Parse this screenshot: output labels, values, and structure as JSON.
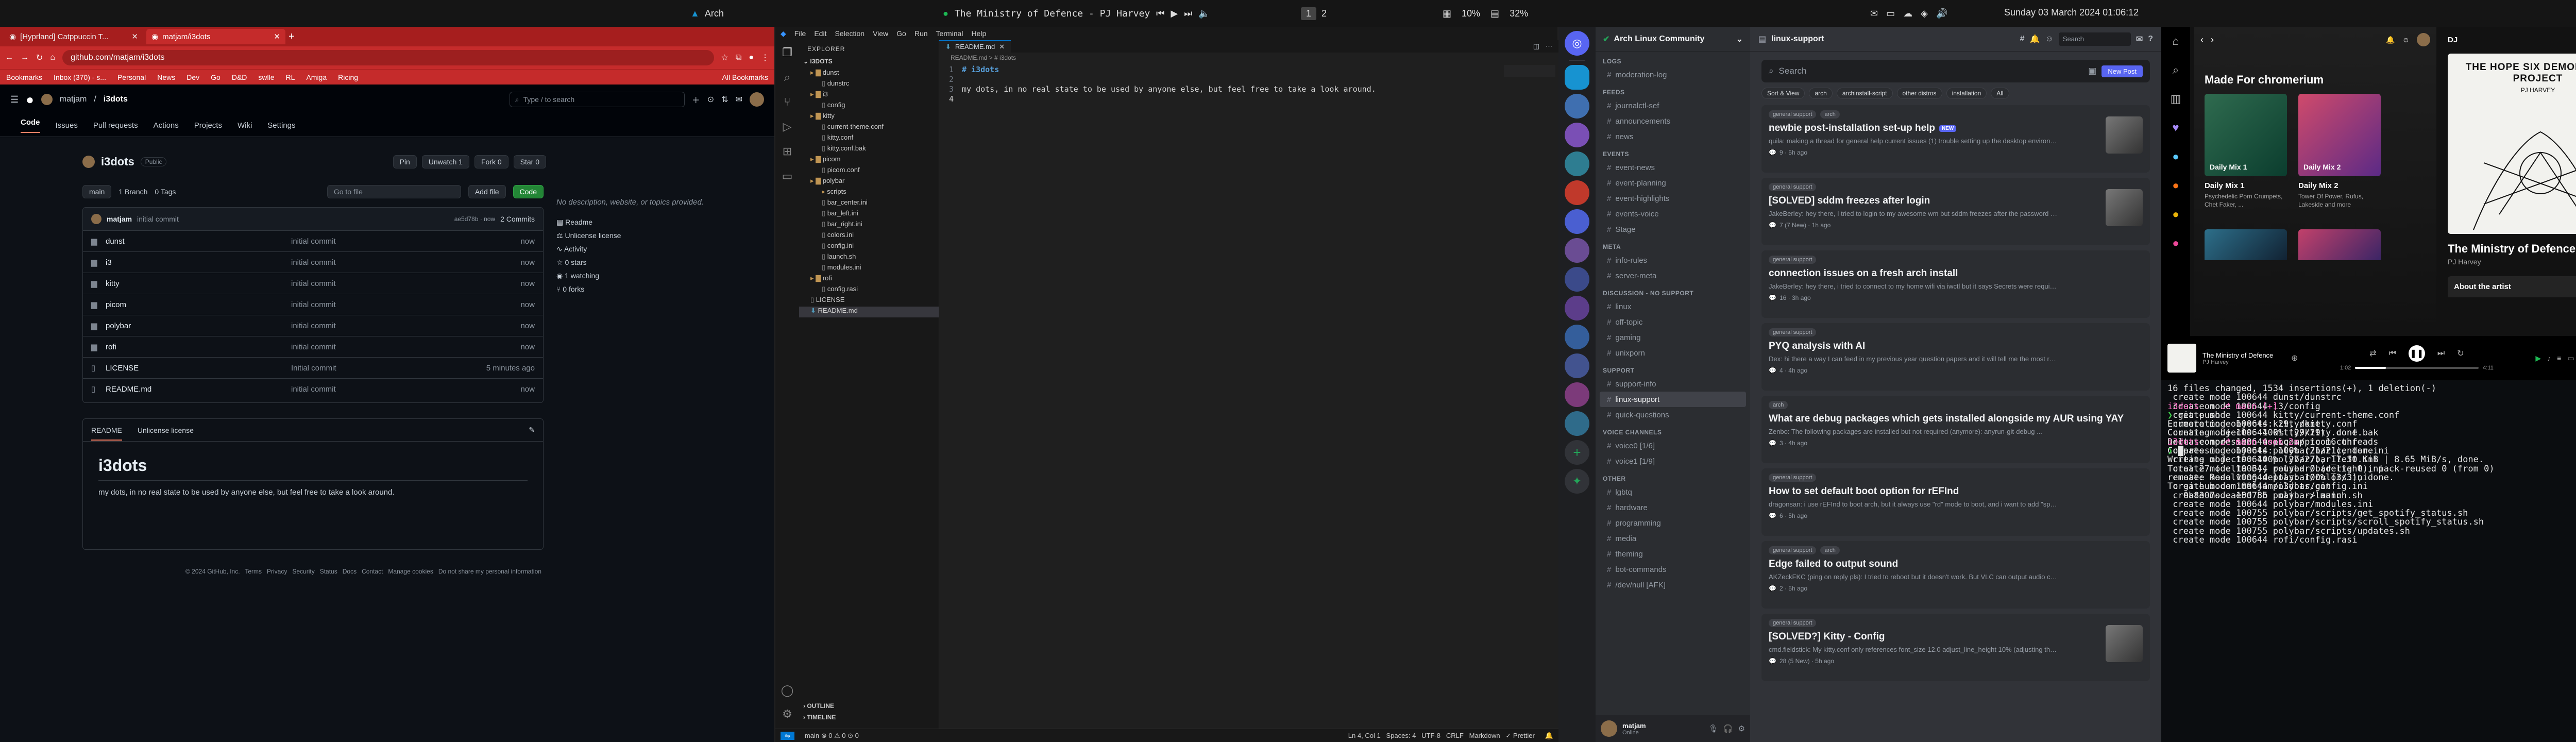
{
  "topbar": {
    "distro": "Arch",
    "now_playing": "The Ministry of Defence - PJ Harvey",
    "ws1": "1",
    "ws2": "2",
    "cpu": "10%",
    "mem": "32%",
    "datetime": "Sunday 03 March 2024 01:06:12"
  },
  "chrome": {
    "tabs": [
      {
        "label": "[Hyprland] Catppuccin T..."
      },
      {
        "label": "matjam/i3dots"
      }
    ],
    "url": "github.com/matjam/i3dots",
    "bookmarks": [
      "Bookmarks",
      "Inbox (370) - s...",
      "Personal",
      "News",
      "Dev",
      "Go",
      "D&D",
      "swlle",
      "RL",
      "Amiga",
      "Ricing",
      "All Bookmarks"
    ],
    "github": {
      "owner": "matjam",
      "repo": "i3dots",
      "search_placeholder": "Type / to search",
      "nav": [
        "Code",
        "Issues",
        "Pull requests",
        "Actions",
        "Projects",
        "Wiki",
        "Settings"
      ],
      "visibility": "Public",
      "pin": "Pin",
      "unwatch": "Unwatch",
      "unwatch_count": "1",
      "fork": "Fork",
      "fork_count": "0",
      "star": "Star",
      "star_count": "0",
      "branch": "main",
      "branch_count": "1 Branch",
      "tag_count": "0 Tags",
      "goto_file": "Go to file",
      "add_file": "Add file",
      "code": "Code",
      "commit_author": "matjam",
      "commit_msg": "initial commit",
      "commit_hash": "ae5d78b · now",
      "commit_count": "2 Commits",
      "files": [
        {
          "name": "dunst",
          "msg": "initial commit",
          "age": "now"
        },
        {
          "name": "i3",
          "msg": "initial commit",
          "age": "now"
        },
        {
          "name": "kitty",
          "msg": "initial commit",
          "age": "now"
        },
        {
          "name": "picom",
          "msg": "initial commit",
          "age": "now"
        },
        {
          "name": "polybar",
          "msg": "initial commit",
          "age": "now"
        },
        {
          "name": "rofi",
          "msg": "initial commit",
          "age": "now"
        },
        {
          "name": "LICENSE",
          "msg": "Initial commit",
          "age": "5 minutes ago"
        },
        {
          "name": "README.md",
          "msg": "initial commit",
          "age": "now"
        }
      ],
      "readme_tab": "README",
      "license_tab": "Unlicense license",
      "readme_title": "i3dots",
      "readme_body": "my dots, in no real state to be used by anyone else, but feel free to take a look around.",
      "about_desc": "No description, website, or topics provided.",
      "about_items": [
        "Readme",
        "Unlicense license",
        "Activity",
        "0 stars",
        "1 watching",
        "0 forks"
      ],
      "footer": "© 2024 GitHub, Inc.   Terms   Privacy   Security   Status   Docs   Contact   Manage cookies   Do not share my personal information"
    }
  },
  "vscode": {
    "menu": [
      "File",
      "Edit",
      "Selection",
      "View",
      "Go",
      "Run",
      "Terminal",
      "Help"
    ],
    "explorer_title": "EXPLORER",
    "root": "I3DOTS",
    "tree": [
      {
        "label": "dunst",
        "d": 1
      },
      {
        "label": "dunstrc",
        "d": 2
      },
      {
        "label": "i3",
        "d": 1
      },
      {
        "label": "config",
        "d": 2
      },
      {
        "label": "kitty",
        "d": 1
      },
      {
        "label": "current-theme.conf",
        "d": 2
      },
      {
        "label": "kitty.conf",
        "d": 2
      },
      {
        "label": "kitty.conf.bak",
        "d": 2
      },
      {
        "label": "picom",
        "d": 1
      },
      {
        "label": "picom.conf",
        "d": 2
      },
      {
        "label": "polybar",
        "d": 1
      },
      {
        "label": "scripts",
        "d": 2
      },
      {
        "label": "bar_center.ini",
        "d": 2
      },
      {
        "label": "bar_left.ini",
        "d": 2
      },
      {
        "label": "bar_right.ini",
        "d": 2
      },
      {
        "label": "colors.ini",
        "d": 2
      },
      {
        "label": "config.ini",
        "d": 2
      },
      {
        "label": "launch.sh",
        "d": 2
      },
      {
        "label": "modules.ini",
        "d": 2
      },
      {
        "label": "rofi",
        "d": 1
      },
      {
        "label": "config.rasi",
        "d": 2
      },
      {
        "label": "LICENSE",
        "d": 1
      },
      {
        "label": "README.md",
        "d": 1
      }
    ],
    "outline": "OUTLINE",
    "timeline": "TIMELINE",
    "tab": "README.md",
    "breadcrumb": "README.md > # i3dots",
    "line1": "# i3dots",
    "line3": "my dots, in no real state to be used by anyone else, but feel free to take a look around.",
    "status_left": "main  ⊗ 0 ⚠ 0  ⊙ 0",
    "status_right": "Ln 4, Col 1   Spaces: 4   UTF-8   CRLF   Markdown   ✓ Prettier"
  },
  "discord": {
    "server": "Arch Linux Community",
    "channel": "linux-support",
    "search": "Search",
    "forum_search": "Search",
    "new_post": "New Post",
    "filters": [
      "Sort & View",
      "arch",
      "archinstall-script",
      "other distros",
      "installation",
      "All"
    ],
    "categories": [
      {
        "name": "LOGS",
        "channels": [
          "moderation-log"
        ]
      },
      {
        "name": "FEEDS",
        "channels": [
          "journalctl-sef",
          "announcements",
          "news"
        ]
      },
      {
        "name": "EVENTS",
        "channels": [
          "event-news",
          "event-planning",
          "event-highlights",
          "events-voice",
          "Stage"
        ]
      },
      {
        "name": "META",
        "channels": [
          "info-rules",
          "server-meta"
        ]
      },
      {
        "name": "DISCUSSION - NO SUPPORT",
        "channels": [
          "linux",
          "off-topic",
          "gaming",
          "unixporn"
        ]
      },
      {
        "name": "SUPPORT",
        "channels": [
          "support-info",
          "linux-support",
          "quick-questions"
        ]
      },
      {
        "name": "VOICE CHANNELS",
        "channels": [
          "voice0 [1/6]",
          "voice1 [1/9]"
        ]
      },
      {
        "name": "OTHER",
        "channels": [
          "lgbtq",
          "hardware",
          "programming",
          "media",
          "theming",
          "bot-commands",
          "/dev/null [AFK]"
        ]
      }
    ],
    "user": "matjam",
    "user_status": "Online",
    "posts": [
      {
        "tags": [
          "general support",
          "arch"
        ],
        "title": "newbie post-installation set-up help",
        "badge": "NEW",
        "preview": "quila: making a thread for general help current issues (1) trouble setting up the desktop environment...",
        "meta": "9 · 5h ago"
      },
      {
        "tags": [
          "general support"
        ],
        "title": "[SOLVED] sddm freezes after login",
        "preview": "JakeBerley: hey there, I tried to login to my awesome wm but sddm freezes after the password was t...",
        "meta": "7 (7 New) · 1h ago"
      },
      {
        "tags": [
          "general support"
        ],
        "title": "connection issues on a fresh arch install",
        "preview": "JakeBerley: hey there, i tried to connect to my home wifi via iwctl but it says Secrets were required but not provided",
        "meta": "16 · 3h ago"
      },
      {
        "tags": [
          "general support"
        ],
        "title": "PYQ analysis with AI",
        "preview": "Dex: hi there a way I can feed in my previous year question papers and it will tell me the most recurring concepts so...",
        "meta": "4 · 4h ago"
      },
      {
        "tags": [
          "arch"
        ],
        "title": "What are debug packages which gets installed alongside my AUR using YAY",
        "preview": "Zenbo: The following packages are installed but not required (anymore): anyrun-git-debug ...",
        "meta": "3 · 4h ago"
      },
      {
        "tags": [
          "general support"
        ],
        "title": "How to set default boot option for rEFInd",
        "preview": "dragonsan: i use rEFInd to boot arch, but it always use \"rd\" mode to boot, and i want to add \"splash\" option, but it c...",
        "meta": "6 · 5h ago"
      },
      {
        "tags": [
          "general support",
          "arch"
        ],
        "title": "Edge failed to output sound",
        "preview": "AKZeckFKC (ping on reply pls): I tried to reboot but it doesn't work. But VLC can output audio correctly, as well as F...",
        "meta": "2 · 5h ago"
      },
      {
        "tags": [
          "general support"
        ],
        "title": "[SOLVED?] Kitty - Config",
        "preview": "cmd.fieldstick: My kitty.conf only references font_size 12.0 adjust_line_height 10% (adjusting the siz...",
        "meta": "28 (5 New) · 5h ago"
      }
    ]
  },
  "spotify": {
    "section": "Made For chromerium",
    "mixes": [
      {
        "title": "Daily Mix 1",
        "desc": "Psychedelic Porn Crumpets, Chet Faker, ..."
      },
      {
        "title": "Daily Mix 2",
        "desc": "Tower Of Power, Rufus, Lakeside and more"
      }
    ],
    "np_label": "DJ",
    "album_art_text": "THE HOPE SIX DEMOLITION PROJECT",
    "album_artist_text": "PJ HARVEY",
    "track": "The Ministry of Defence",
    "artist": "PJ Harvey",
    "about": "About the artist",
    "pos": "1:02",
    "dur": "4:11",
    "progress": 0.25
  },
  "terminal": {
    "lines": [
      "16 files changed, 1534 insertions(+), 1 deletion(-)",
      " create mode 100644 dunst/dunstrc",
      " create mode 100644 i3/config",
      " create mode 100644 kitty/current-theme.conf",
      " create mode 100644 kitty/kitty.conf",
      " create mode 100644 kitty/kitty.conf.bak",
      " create mode 100644 picom/picom.conf",
      " create mode 100644 polybar/bar_center.ini",
      " create mode 100644 polybar/bar_left.ini",
      " create mode 100644 polybar/bar_right.ini",
      " create mode 100644 polybar/colors.ini",
      " create mode 100644 polybar/config.ini",
      " create mode 100755 polybar/launch.sh",
      " create mode 100644 polybar/modules.ini",
      " create mode 100755 polybar/scripts/get_spotify_status.sh",
      " create mode 100755 polybar/scripts/scroll_spotify_status.sh",
      " create mode 100755 polybar/scripts/updates.sh",
      " create mode 100644 rofi/config.rasi"
    ],
    "prompt1_dir": "i3dots",
    "prompt1_branch": "main [+]",
    "cmd1": "git push",
    "lines2": [
      "Enumerating objects: 29, done.",
      "Counting objects: 100% (29/29), done.",
      "Delta compression using up to 16 threads",
      "Compressing objects: 100% (21/21), done.",
      "Writing objects: 100% (27/27), 17.30 KiB | 8.65 MiB/s, done.",
      "Total 27 (delta 3), reused 0 (delta 0), pack-reused 0 (from 0)",
      "remote: Resolving deltas: 100% (3/3), done.",
      "To github.com:matjam/i3dots.git",
      "   0b8307s..ae5d78b  main -> main"
    ],
    "prompt2_dir": "i3dots",
    "prompt2_branch": "main took 2s"
  }
}
